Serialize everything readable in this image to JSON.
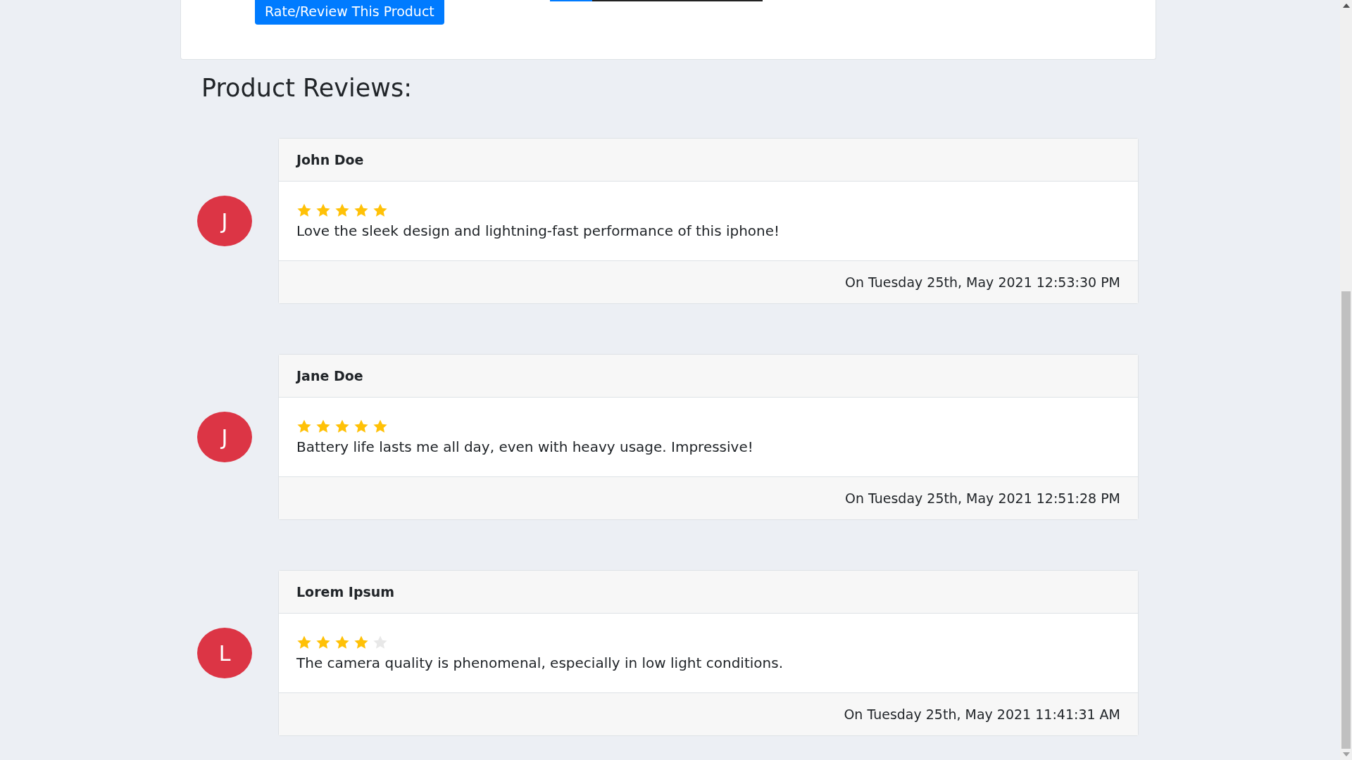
{
  "top_card": {
    "button": "Rate/Review This Product",
    "rating_bar": {
      "level": 0.2
    }
  },
  "heading": "Product Reviews:",
  "reviews": [
    {
      "initial": "J",
      "name": "John Doe",
      "stars": 5,
      "text": "Love the sleek design and lightning-fast performance of this iphone!",
      "date": "On Tuesday 25th, May 2021 12:53:30 PM"
    },
    {
      "initial": "J",
      "name": "Jane Doe",
      "stars": 5,
      "text": "Battery life lasts me all day, even with heavy usage. Impressive!",
      "date": "On Tuesday 25th, May 2021 12:51:28 PM"
    },
    {
      "initial": "L",
      "name": "Lorem Ipsum",
      "stars": 4,
      "text": "The camera quality is phenomenal, especially in low light conditions.",
      "date": "On Tuesday 25th, May 2021 11:41:31 AM"
    }
  ]
}
